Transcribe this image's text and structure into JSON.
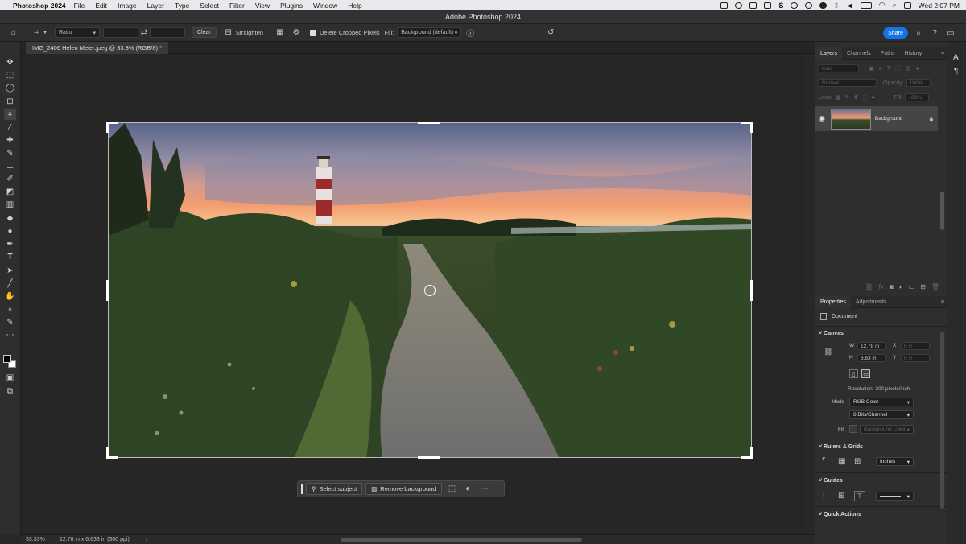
{
  "menubar": {
    "app": "Photoshop 2024",
    "items": [
      "File",
      "Edit",
      "Image",
      "Layer",
      "Type",
      "Select",
      "Filter",
      "View",
      "Plugins",
      "Window",
      "Help"
    ],
    "clock": "Wed 2:07 PM"
  },
  "window": {
    "title": "Adobe Photoshop 2024"
  },
  "options": {
    "ratio": "Ratio",
    "clear": "Clear",
    "straighten": "Straighten",
    "delete_cropped": "Delete Cropped Pixels",
    "fill_label": "Fill:",
    "fill_value": "Background (default)",
    "share": "Share"
  },
  "document": {
    "tab": "IMG_2406 Helen Meier.jpeg @ 33.3% (RGB/8) *"
  },
  "status": {
    "zoom": "33.33%",
    "info": "12.78 in x 6.633 in (300 ppi)"
  },
  "context_bar": {
    "select_subject": "Select subject",
    "remove_background": "Remove background"
  },
  "layers_panel": {
    "tabs": [
      "Layers",
      "Channels",
      "Paths",
      "History"
    ],
    "kind": "Kind",
    "blend": "Normal",
    "opacity_label": "Opacity:",
    "opacity": "100%",
    "lock_label": "Lock:",
    "fill_label": "Fill:",
    "fill": "100%",
    "layer_name": "Background"
  },
  "properties_panel": {
    "tabs": [
      "Properties",
      "Adjustments"
    ],
    "doc_label": "Document",
    "canvas_section": "Canvas",
    "w_label": "W",
    "w_value": "12.78 in",
    "h_label": "H",
    "h_value": "6.63 in",
    "x_label": "X",
    "y_label": "Y",
    "x_value": "0 in",
    "y_value": "0 in",
    "resolution": "Resolution: 300 pixels/inch",
    "mode_label": "Mode",
    "mode_value": "RGB Color",
    "bits_value": "8 Bits/Channel",
    "fill_label": "Fill",
    "fill_value": "Background Color",
    "rulers_section": "Rulers & Grids",
    "units_value": "Inches",
    "guides_section": "Guides",
    "quick_actions": "Quick Actions"
  },
  "colors": {
    "accent": "#1473e6",
    "panel": "#2e2e2e",
    "workspace": "#262626"
  }
}
